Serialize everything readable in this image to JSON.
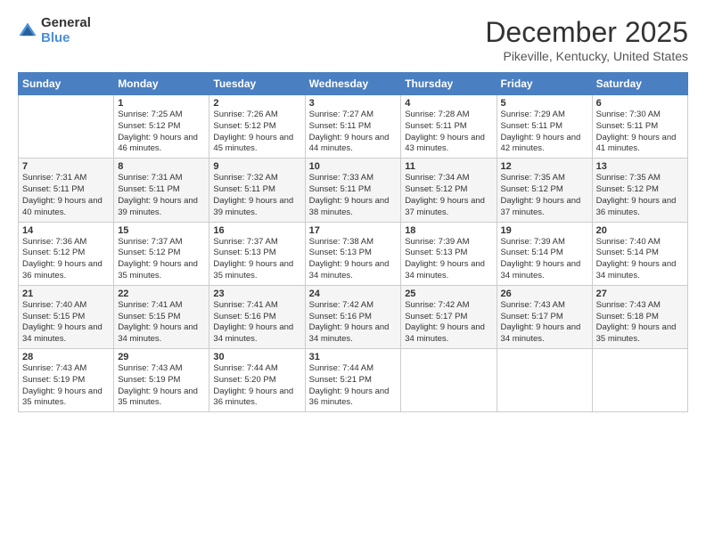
{
  "logo": {
    "general": "General",
    "blue": "Blue"
  },
  "title": "December 2025",
  "location": "Pikeville, Kentucky, United States",
  "days_of_week": [
    "Sunday",
    "Monday",
    "Tuesday",
    "Wednesday",
    "Thursday",
    "Friday",
    "Saturday"
  ],
  "weeks": [
    [
      {
        "day": "",
        "sunrise": "",
        "sunset": "",
        "daylight": ""
      },
      {
        "day": "1",
        "sunrise": "Sunrise: 7:25 AM",
        "sunset": "Sunset: 5:12 PM",
        "daylight": "Daylight: 9 hours and 46 minutes."
      },
      {
        "day": "2",
        "sunrise": "Sunrise: 7:26 AM",
        "sunset": "Sunset: 5:12 PM",
        "daylight": "Daylight: 9 hours and 45 minutes."
      },
      {
        "day": "3",
        "sunrise": "Sunrise: 7:27 AM",
        "sunset": "Sunset: 5:11 PM",
        "daylight": "Daylight: 9 hours and 44 minutes."
      },
      {
        "day": "4",
        "sunrise": "Sunrise: 7:28 AM",
        "sunset": "Sunset: 5:11 PM",
        "daylight": "Daylight: 9 hours and 43 minutes."
      },
      {
        "day": "5",
        "sunrise": "Sunrise: 7:29 AM",
        "sunset": "Sunset: 5:11 PM",
        "daylight": "Daylight: 9 hours and 42 minutes."
      },
      {
        "day": "6",
        "sunrise": "Sunrise: 7:30 AM",
        "sunset": "Sunset: 5:11 PM",
        "daylight": "Daylight: 9 hours and 41 minutes."
      }
    ],
    [
      {
        "day": "7",
        "sunrise": "Sunrise: 7:31 AM",
        "sunset": "Sunset: 5:11 PM",
        "daylight": "Daylight: 9 hours and 40 minutes."
      },
      {
        "day": "8",
        "sunrise": "Sunrise: 7:31 AM",
        "sunset": "Sunset: 5:11 PM",
        "daylight": "Daylight: 9 hours and 39 minutes."
      },
      {
        "day": "9",
        "sunrise": "Sunrise: 7:32 AM",
        "sunset": "Sunset: 5:11 PM",
        "daylight": "Daylight: 9 hours and 39 minutes."
      },
      {
        "day": "10",
        "sunrise": "Sunrise: 7:33 AM",
        "sunset": "Sunset: 5:11 PM",
        "daylight": "Daylight: 9 hours and 38 minutes."
      },
      {
        "day": "11",
        "sunrise": "Sunrise: 7:34 AM",
        "sunset": "Sunset: 5:12 PM",
        "daylight": "Daylight: 9 hours and 37 minutes."
      },
      {
        "day": "12",
        "sunrise": "Sunrise: 7:35 AM",
        "sunset": "Sunset: 5:12 PM",
        "daylight": "Daylight: 9 hours and 37 minutes."
      },
      {
        "day": "13",
        "sunrise": "Sunrise: 7:35 AM",
        "sunset": "Sunset: 5:12 PM",
        "daylight": "Daylight: 9 hours and 36 minutes."
      }
    ],
    [
      {
        "day": "14",
        "sunrise": "Sunrise: 7:36 AM",
        "sunset": "Sunset: 5:12 PM",
        "daylight": "Daylight: 9 hours and 36 minutes."
      },
      {
        "day": "15",
        "sunrise": "Sunrise: 7:37 AM",
        "sunset": "Sunset: 5:12 PM",
        "daylight": "Daylight: 9 hours and 35 minutes."
      },
      {
        "day": "16",
        "sunrise": "Sunrise: 7:37 AM",
        "sunset": "Sunset: 5:13 PM",
        "daylight": "Daylight: 9 hours and 35 minutes."
      },
      {
        "day": "17",
        "sunrise": "Sunrise: 7:38 AM",
        "sunset": "Sunset: 5:13 PM",
        "daylight": "Daylight: 9 hours and 34 minutes."
      },
      {
        "day": "18",
        "sunrise": "Sunrise: 7:39 AM",
        "sunset": "Sunset: 5:13 PM",
        "daylight": "Daylight: 9 hours and 34 minutes."
      },
      {
        "day": "19",
        "sunrise": "Sunrise: 7:39 AM",
        "sunset": "Sunset: 5:14 PM",
        "daylight": "Daylight: 9 hours and 34 minutes."
      },
      {
        "day": "20",
        "sunrise": "Sunrise: 7:40 AM",
        "sunset": "Sunset: 5:14 PM",
        "daylight": "Daylight: 9 hours and 34 minutes."
      }
    ],
    [
      {
        "day": "21",
        "sunrise": "Sunrise: 7:40 AM",
        "sunset": "Sunset: 5:15 PM",
        "daylight": "Daylight: 9 hours and 34 minutes."
      },
      {
        "day": "22",
        "sunrise": "Sunrise: 7:41 AM",
        "sunset": "Sunset: 5:15 PM",
        "daylight": "Daylight: 9 hours and 34 minutes."
      },
      {
        "day": "23",
        "sunrise": "Sunrise: 7:41 AM",
        "sunset": "Sunset: 5:16 PM",
        "daylight": "Daylight: 9 hours and 34 minutes."
      },
      {
        "day": "24",
        "sunrise": "Sunrise: 7:42 AM",
        "sunset": "Sunset: 5:16 PM",
        "daylight": "Daylight: 9 hours and 34 minutes."
      },
      {
        "day": "25",
        "sunrise": "Sunrise: 7:42 AM",
        "sunset": "Sunset: 5:17 PM",
        "daylight": "Daylight: 9 hours and 34 minutes."
      },
      {
        "day": "26",
        "sunrise": "Sunrise: 7:43 AM",
        "sunset": "Sunset: 5:17 PM",
        "daylight": "Daylight: 9 hours and 34 minutes."
      },
      {
        "day": "27",
        "sunrise": "Sunrise: 7:43 AM",
        "sunset": "Sunset: 5:18 PM",
        "daylight": "Daylight: 9 hours and 35 minutes."
      }
    ],
    [
      {
        "day": "28",
        "sunrise": "Sunrise: 7:43 AM",
        "sunset": "Sunset: 5:19 PM",
        "daylight": "Daylight: 9 hours and 35 minutes."
      },
      {
        "day": "29",
        "sunrise": "Sunrise: 7:43 AM",
        "sunset": "Sunset: 5:19 PM",
        "daylight": "Daylight: 9 hours and 35 minutes."
      },
      {
        "day": "30",
        "sunrise": "Sunrise: 7:44 AM",
        "sunset": "Sunset: 5:20 PM",
        "daylight": "Daylight: 9 hours and 36 minutes."
      },
      {
        "day": "31",
        "sunrise": "Sunrise: 7:44 AM",
        "sunset": "Sunset: 5:21 PM",
        "daylight": "Daylight: 9 hours and 36 minutes."
      },
      {
        "day": "",
        "sunrise": "",
        "sunset": "",
        "daylight": ""
      },
      {
        "day": "",
        "sunrise": "",
        "sunset": "",
        "daylight": ""
      },
      {
        "day": "",
        "sunrise": "",
        "sunset": "",
        "daylight": ""
      }
    ]
  ]
}
